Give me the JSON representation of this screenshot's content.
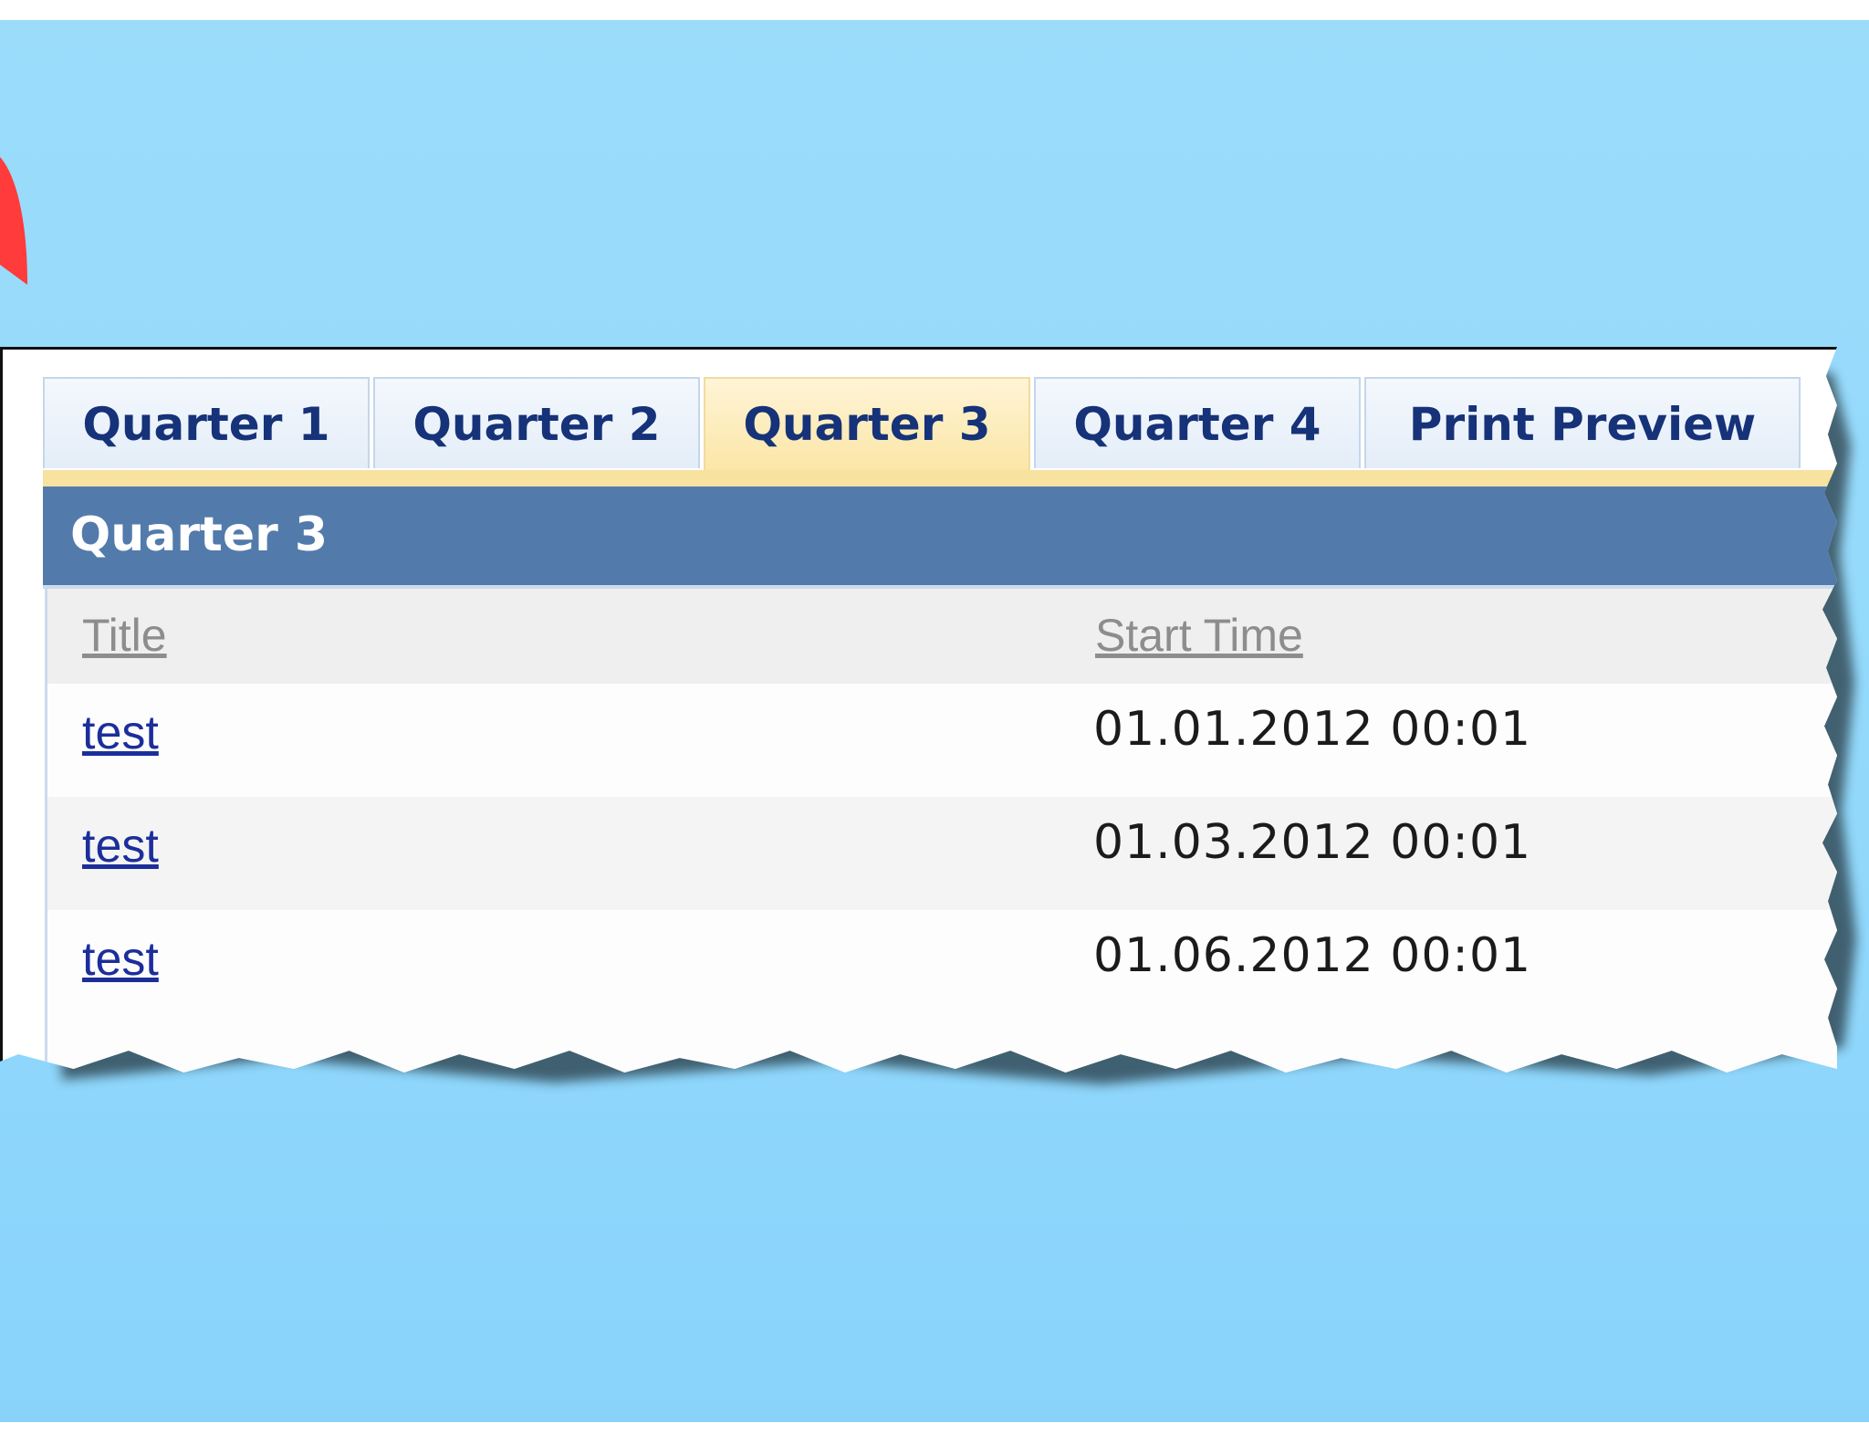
{
  "tabs": [
    {
      "label": "Quarter 1"
    },
    {
      "label": "Quarter 2"
    },
    {
      "label": "Quarter 3"
    },
    {
      "label": "Quarter 4"
    },
    {
      "label": "Print Preview"
    }
  ],
  "active_tab": "Quarter 3",
  "panel": {
    "title": "Quarter 3"
  },
  "table": {
    "columns": [
      "Title",
      "Start Time"
    ],
    "rows": [
      {
        "title": "test",
        "start_time": "01.01.2012 00:01"
      },
      {
        "title": "test",
        "start_time": "01.03.2012 00:01"
      },
      {
        "title": "test",
        "start_time": "01.06.2012 00:01"
      }
    ]
  },
  "colors": {
    "background": "#93d9fb",
    "active_tab": "#fbe6a6",
    "panel_header": "#527bab",
    "tab_text": "#163278",
    "link": "#1c2e9a",
    "arrow": "#ff3b3b"
  }
}
